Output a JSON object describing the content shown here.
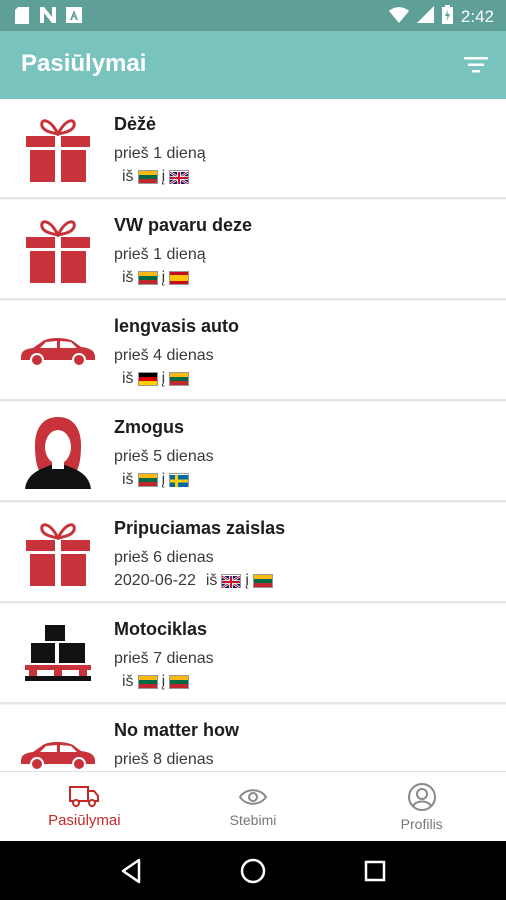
{
  "status_bar": {
    "time": "2:42",
    "icons": [
      "sd-card-icon",
      "n-icon",
      "a-icon",
      "wifi-icon",
      "signal-icon",
      "battery-icon"
    ]
  },
  "app_bar": {
    "title": "Pasiūlymai",
    "filter_icon": "filter-icon"
  },
  "colors": {
    "header": "#78c3bd",
    "status": "#5e9f98",
    "accent": "#c62828",
    "icon_red": "#c8323a"
  },
  "offers": [
    {
      "title": "Dėžė",
      "time": "prieš 1 dieną",
      "date": "",
      "from_label": "iš",
      "to_label": "į",
      "from": "LT",
      "to": "GB",
      "icon": "gift-icon"
    },
    {
      "title": "VW pavaru deze",
      "time": "prieš 1 dieną",
      "date": "",
      "from_label": "iš",
      "to_label": "į",
      "from": "LT",
      "to": "ES",
      "icon": "gift-icon"
    },
    {
      "title": "lengvasis auto",
      "time": "prieš 4 dienas",
      "date": "",
      "from_label": "iš",
      "to_label": "į",
      "from": "DE",
      "to": "LT",
      "icon": "car-icon"
    },
    {
      "title": "Zmogus",
      "time": "prieš 5 dienas",
      "date": "",
      "from_label": "iš",
      "to_label": "į",
      "from": "LT",
      "to": "SE",
      "icon": "person-icon"
    },
    {
      "title": "Pripuciamas zaislas",
      "time": "prieš 6 dienas",
      "date": "2020-06-22",
      "from_label": "iš",
      "to_label": "į",
      "from": "GB",
      "to": "LT",
      "icon": "gift-icon"
    },
    {
      "title": "Motociklas",
      "time": "prieš 7 dienas",
      "date": "",
      "from_label": "iš",
      "to_label": "į",
      "from": "LT",
      "to": "LT",
      "icon": "pallet-boxes-icon"
    },
    {
      "title": "No matter how",
      "time": "prieš 8 dienas",
      "date": "",
      "from_label": "",
      "to_label": "",
      "from": "",
      "to": "",
      "icon": "car-icon"
    }
  ],
  "bottom_nav": [
    {
      "label": "Pasiūlymai",
      "icon": "truck-icon",
      "active": true
    },
    {
      "label": "Stebimi",
      "icon": "eye-icon",
      "active": false
    },
    {
      "label": "Profilis",
      "icon": "profile-icon",
      "active": false
    }
  ],
  "system_nav": [
    "back-icon",
    "home-icon",
    "recents-icon"
  ]
}
